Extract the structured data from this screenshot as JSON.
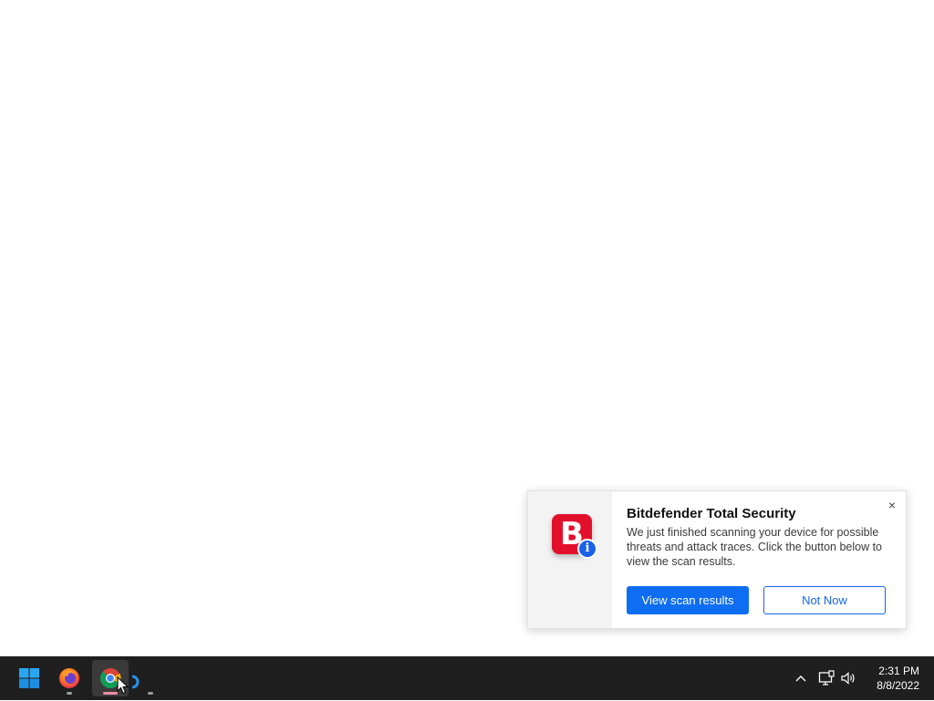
{
  "notification": {
    "app_name": "Bitdefender Total Security",
    "message": "We just finished scanning your device for possible threats and attack traces. Click the button below to view the scan results.",
    "logo_letter": "B",
    "badge_letter": "i",
    "close_label": "×",
    "primary_button": "View scan results",
    "secondary_button": "Not Now",
    "colors": {
      "logo": "#e3102d",
      "badge": "#1a62e8",
      "primary": "#0f6df2"
    }
  },
  "taskbar": {
    "apps": [
      {
        "name": "Start",
        "icon": "windows-logo-icon"
      },
      {
        "name": "Firefox",
        "icon": "firefox-icon"
      },
      {
        "name": "Chrome",
        "icon": "chrome-icon",
        "active": true
      },
      {
        "name": "App",
        "icon": "circle-app-icon"
      }
    ],
    "tray": {
      "icons": [
        "chevron-up-icon",
        "network-icon",
        "volume-icon"
      ],
      "time": "2:31 PM",
      "date": "8/8/2022"
    }
  }
}
